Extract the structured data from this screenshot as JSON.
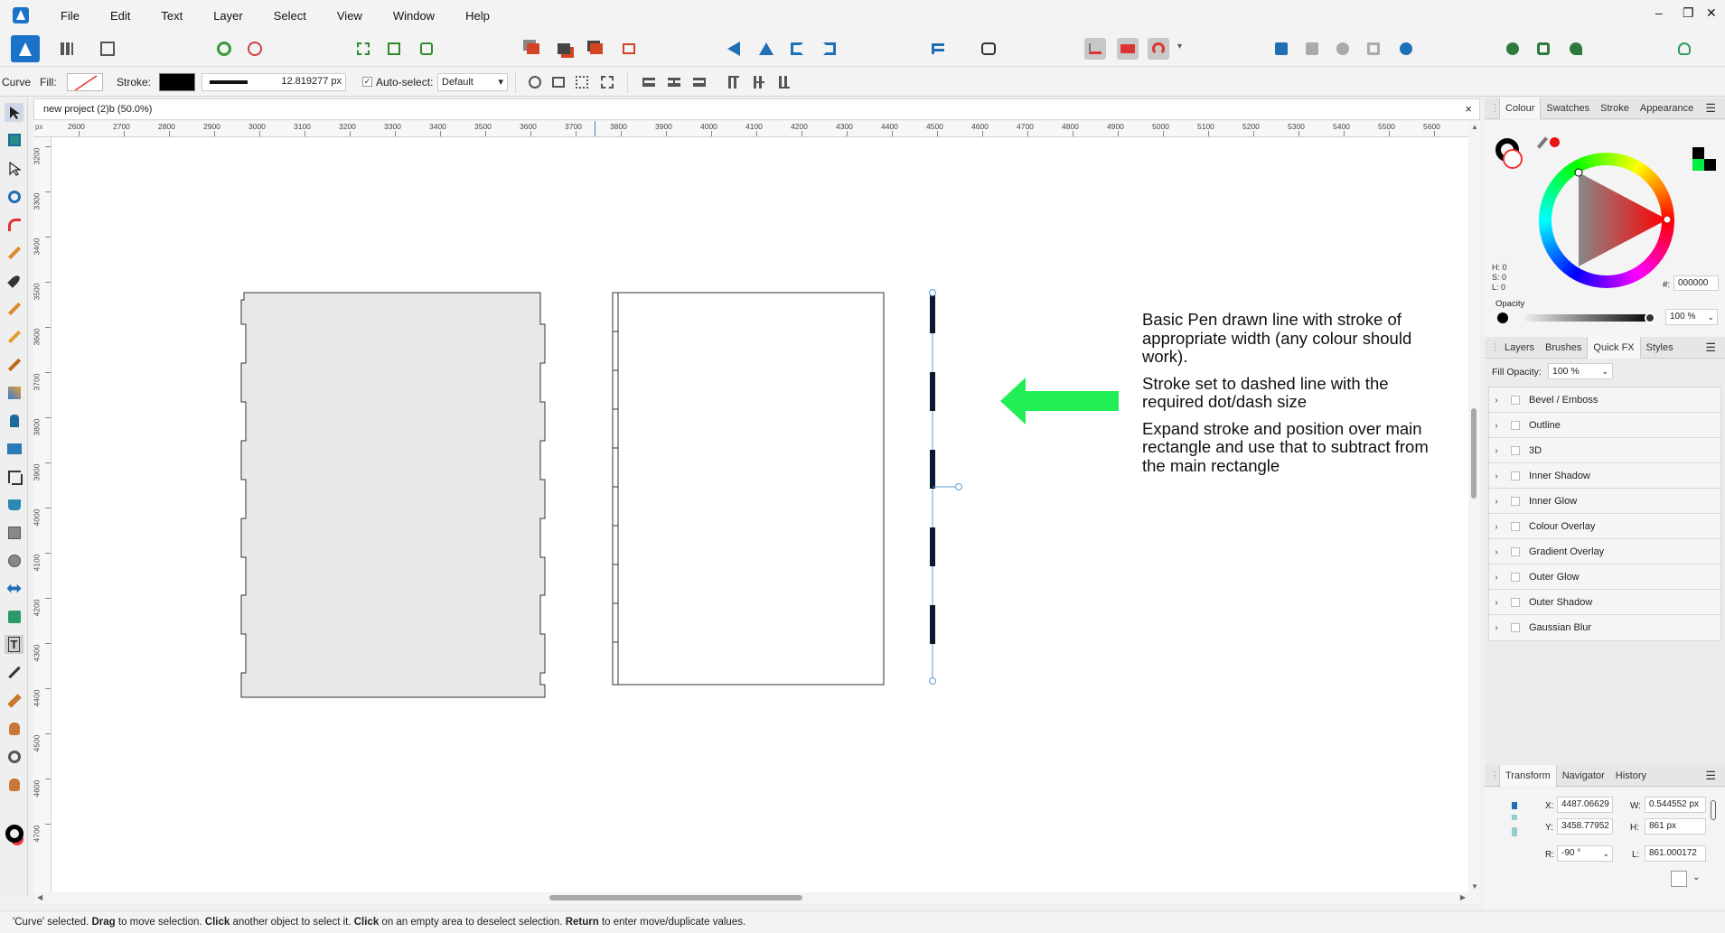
{
  "menu": [
    "File",
    "Edit",
    "Text",
    "Layer",
    "Select",
    "View",
    "Window",
    "Help"
  ],
  "window_controls": {
    "minimize": "–",
    "restore": "❐",
    "close": "✕"
  },
  "context_bar": {
    "tool_label": "Curve",
    "fill_label": "Fill:",
    "stroke_label": "Stroke:",
    "stroke_width": "12.819277 px",
    "auto_select_label": "Auto-select:",
    "auto_select_value": "Default"
  },
  "document": {
    "tab_title": "new project (2)b (50.0%)",
    "close": "×",
    "ruler_unit": "px"
  },
  "ruler": {
    "h_ticks": [
      "2600",
      "2700",
      "2800",
      "2900",
      "3000",
      "3100",
      "3200",
      "3300",
      "3400",
      "3500",
      "3600",
      "3700",
      "3800",
      "3900",
      "4000",
      "4100",
      "4200",
      "4300",
      "4400",
      "4500",
      "4600",
      "4700",
      "4800",
      "4900",
      "5000",
      "5100",
      "5200",
      "5300",
      "5400",
      "5500",
      "5600"
    ],
    "v_ticks": [
      "3200",
      "3300",
      "3400",
      "3500",
      "3600",
      "3700",
      "3800",
      "3900",
      "4000",
      "4100",
      "4200",
      "4300",
      "4400",
      "4500",
      "4600",
      "4700"
    ]
  },
  "annotation": {
    "para1": "Basic Pen drawn line with stroke of appropriate width (any colour should work).",
    "para2": "Stroke set to dashed line with the required dot/dash size",
    "para3": "Expand stroke and position over main rectangle and use that to subtract from the main rectangle",
    "arrow_color": "#22ee55"
  },
  "colour_panel": {
    "tabs": [
      "Colour",
      "Swatches",
      "Stroke",
      "Appearance"
    ],
    "active_tab": "Colour",
    "h": "H: 0",
    "s": "S: 0",
    "l": "L: 0",
    "hex_label": "#:",
    "hex_value": "000000",
    "opacity_label": "Opacity",
    "opacity_value": "100 %"
  },
  "fx_panel": {
    "tabs": [
      "Layers",
      "Brushes",
      "Quick FX",
      "Styles"
    ],
    "active_tab": "Quick FX",
    "fill_opacity_label": "Fill Opacity:",
    "fill_opacity_value": "100 %",
    "effects": [
      "Bevel / Emboss",
      "Outline",
      "3D",
      "Inner Shadow",
      "Inner Glow",
      "Colour Overlay",
      "Gradient Overlay",
      "Outer Glow",
      "Outer Shadow",
      "Gaussian Blur"
    ]
  },
  "transform_panel": {
    "tabs": [
      "Transform",
      "Navigator",
      "History"
    ],
    "active_tab": "Transform",
    "x_label": "X:",
    "x_value": "4487.06629",
    "y_label": "Y:",
    "y_value": "3458.77952",
    "w_label": "W:",
    "w_value": "0.544552 px",
    "h_label": "H:",
    "h_value": "861 px",
    "r_label": "R:",
    "r_value": "-90 °",
    "l_label": "L:",
    "l_value": "861.000172"
  },
  "status_bar": {
    "p1": "'Curve' selected. ",
    "b1": "Drag",
    " p2": "",
    "text_a": " to move selection. ",
    "b2": "Click",
    "text_b": " another object to select it. ",
    "b3": "Click",
    "text_c": " on an empty area to deselect selection. ",
    "b4": "Return",
    "text_d": " to enter move/duplicate values."
  }
}
